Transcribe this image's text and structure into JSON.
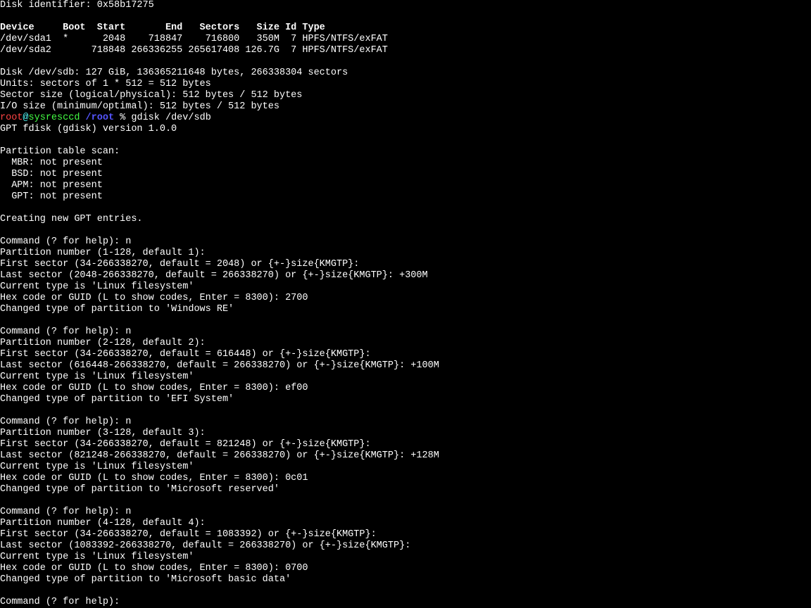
{
  "disk_identifier": "Disk identifier: 0x58b17275",
  "blank": "",
  "header": "Device     Boot  Start       End   Sectors   Size Id Type",
  "row1": "/dev/sda1  *      2048    718847    716800   350M  7 HPFS/NTFS/exFAT",
  "row2": "/dev/sda2       718848 266336255 265617408 126.7G  7 HPFS/NTFS/exFAT",
  "sdb_info1": "Disk /dev/sdb: 127 GiB, 136365211648 bytes, 266338304 sectors",
  "sdb_info2": "Units: sectors of 1 * 512 = 512 bytes",
  "sdb_info3": "Sector size (logical/physical): 512 bytes / 512 bytes",
  "sdb_info4": "I/O size (minimum/optimal): 512 bytes / 512 bytes",
  "prompt_user": "root",
  "prompt_at": "@",
  "prompt_host": "sysresccd",
  "prompt_path": "/root",
  "prompt_pct": " % ",
  "prompt_cmd": "gdisk /dev/sdb",
  "gdisk_ver": "GPT fdisk (gdisk) version 1.0.0",
  "scan_hdr": "Partition table scan:",
  "scan1": "  MBR: not present",
  "scan2": "  BSD: not present",
  "scan3": "  APM: not present",
  "scan4": "  GPT: not present",
  "creating": "Creating new GPT entries.",
  "cmd1": "Command (? for help): n",
  "p1_num": "Partition number (1-128, default 1): ",
  "p1_first": "First sector (34-266338270, default = 2048) or {+-}size{KMGTP}: ",
  "p1_last": "Last sector (2048-266338270, default = 266338270) or {+-}size{KMGTP}: +300M",
  "p1_cur": "Current type is 'Linux filesystem'",
  "p1_hex": "Hex code or GUID (L to show codes, Enter = 8300): 2700",
  "p1_chg": "Changed type of partition to 'Windows RE'",
  "cmd2": "Command (? for help): n",
  "p2_num": "Partition number (2-128, default 2): ",
  "p2_first": "First sector (34-266338270, default = 616448) or {+-}size{KMGTP}: ",
  "p2_last": "Last sector (616448-266338270, default = 266338270) or {+-}size{KMGTP}: +100M",
  "p2_cur": "Current type is 'Linux filesystem'",
  "p2_hex": "Hex code or GUID (L to show codes, Enter = 8300): ef00",
  "p2_chg": "Changed type of partition to 'EFI System'",
  "cmd3": "Command (? for help): n",
  "p3_num": "Partition number (3-128, default 3): ",
  "p3_first": "First sector (34-266338270, default = 821248) or {+-}size{KMGTP}: ",
  "p3_last": "Last sector (821248-266338270, default = 266338270) or {+-}size{KMGTP}: +128M",
  "p3_cur": "Current type is 'Linux filesystem'",
  "p3_hex": "Hex code or GUID (L to show codes, Enter = 8300): 0c01",
  "p3_chg": "Changed type of partition to 'Microsoft reserved'",
  "cmd4": "Command (? for help): n",
  "p4_num": "Partition number (4-128, default 4): ",
  "p4_first": "First sector (34-266338270, default = 1083392) or {+-}size{KMGTP}: ",
  "p4_last": "Last sector (1083392-266338270, default = 266338270) or {+-}size{KMGTP}: ",
  "p4_cur": "Current type is 'Linux filesystem'",
  "p4_hex": "Hex code or GUID (L to show codes, Enter = 8300): 0700",
  "p4_chg": "Changed type of partition to 'Microsoft basic data'",
  "cmd5": "Command (? for help): "
}
